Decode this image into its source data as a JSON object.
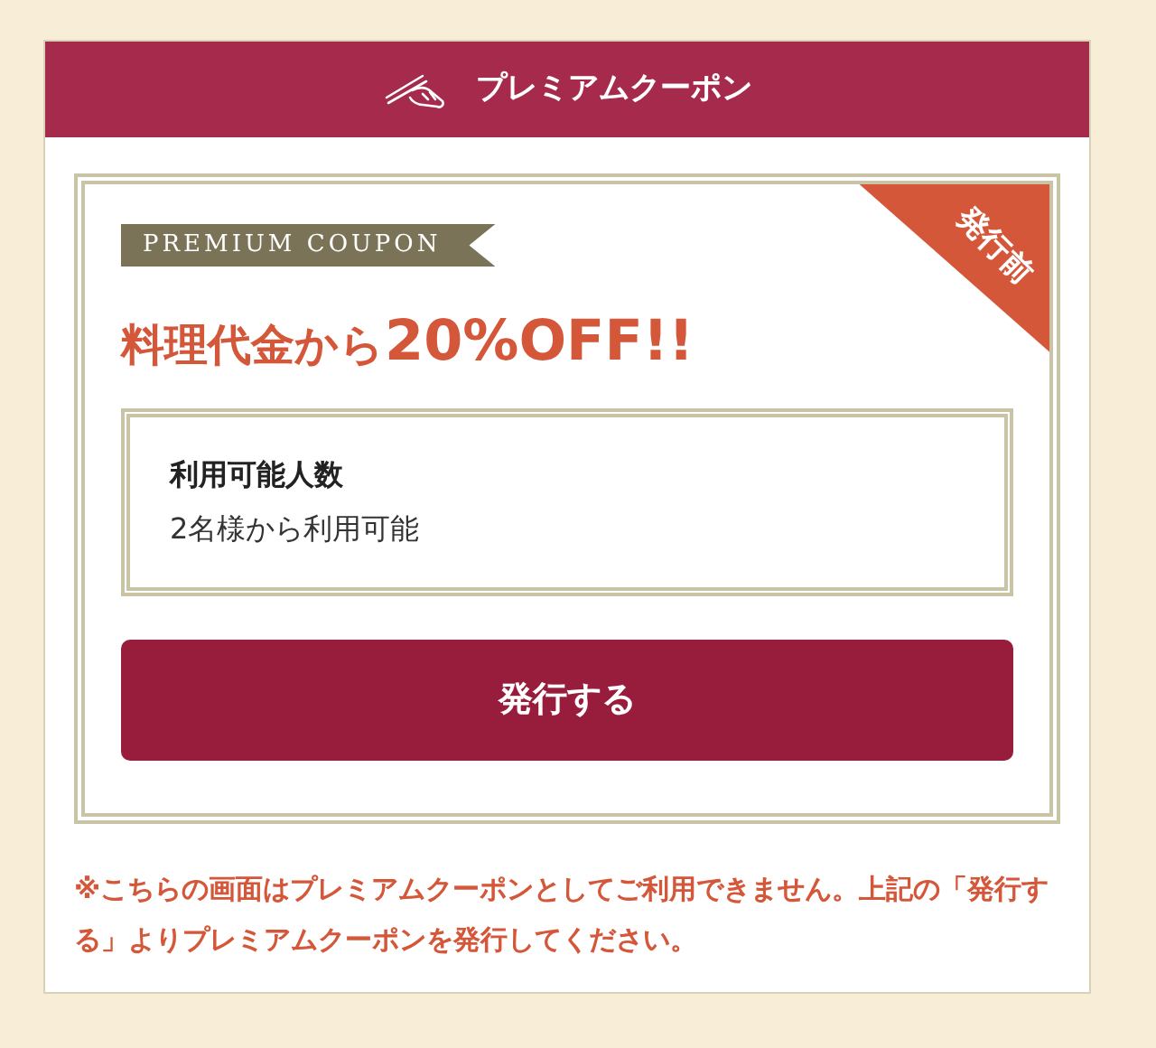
{
  "header": {
    "title": "プレミアムクーポン"
  },
  "coupon": {
    "label": "PREMIUM COUPON",
    "ribbon": "発行前",
    "title_prefix": "料理代金から",
    "title_emphasis": "20%OFF!!",
    "info": {
      "heading": "利用可能人数",
      "value": "2名様から利用可能"
    },
    "button": "発行する"
  },
  "note": "※こちらの画面はプレミアムクーポンとしてご利用できません。上記の「発行する」よりプレミアムクーポンを発行してください。"
}
